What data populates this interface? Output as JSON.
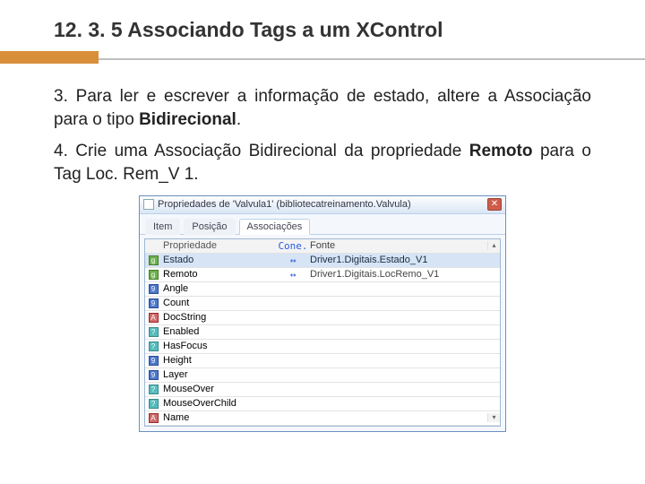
{
  "heading": "12. 3. 5 Associando Tags a um XControl",
  "body": {
    "p1a": "3. Para ler e escrever a informação de estado, altere a Associação para o tipo ",
    "p1b": "Bidirecional",
    "p1c": ".",
    "p2a": "4. Crie uma Associação Bidirecional da propriedade ",
    "p2b": "Remoto",
    "p2c": " para o Tag Loc. Rem_V 1."
  },
  "dialog": {
    "title": "Propriedades de 'Valvula1' (bibliotecatreinamento.Valvula)",
    "tabs": [
      "Item",
      "Posição",
      "Associações"
    ],
    "active_tab": 2,
    "columns": [
      "Propriedade",
      "Cone.",
      "Fonte"
    ],
    "rows": [
      {
        "icon": "g",
        "iconClass": "",
        "prop": "Estado",
        "sel": true,
        "cone": "↔",
        "font": "Driver1.Digitais.Estado_V1"
      },
      {
        "icon": "g",
        "iconClass": "",
        "prop": "Remoto",
        "sel": false,
        "cone": "↔",
        "font": "Driver1.Digitais.LocRemo_V1"
      },
      {
        "icon": "9",
        "iconClass": "c9",
        "prop": "Angle",
        "sel": false,
        "cone": "",
        "font": ""
      },
      {
        "icon": "9",
        "iconClass": "c9",
        "prop": "Count",
        "sel": false,
        "cone": "",
        "font": ""
      },
      {
        "icon": "A",
        "iconClass": "cA",
        "prop": "DocString",
        "sel": false,
        "cone": "",
        "font": ""
      },
      {
        "icon": "?",
        "iconClass": "cQ",
        "prop": "Enabled",
        "sel": false,
        "cone": "",
        "font": ""
      },
      {
        "icon": "?",
        "iconClass": "cQ",
        "prop": "HasFocus",
        "sel": false,
        "cone": "",
        "font": ""
      },
      {
        "icon": "9",
        "iconClass": "c9",
        "prop": "Height",
        "sel": false,
        "cone": "",
        "font": ""
      },
      {
        "icon": "9",
        "iconClass": "c9",
        "prop": "Layer",
        "sel": false,
        "cone": "",
        "font": ""
      },
      {
        "icon": "?",
        "iconClass": "cQ",
        "prop": "MouseOver",
        "sel": false,
        "cone": "",
        "font": ""
      },
      {
        "icon": "?",
        "iconClass": "cQ",
        "prop": "MouseOverChild",
        "sel": false,
        "cone": "",
        "font": ""
      },
      {
        "icon": "A",
        "iconClass": "cA",
        "prop": "Name",
        "sel": false,
        "cone": "",
        "font": ""
      }
    ],
    "scroll": {
      "up": "▴",
      "down": "▾"
    }
  }
}
